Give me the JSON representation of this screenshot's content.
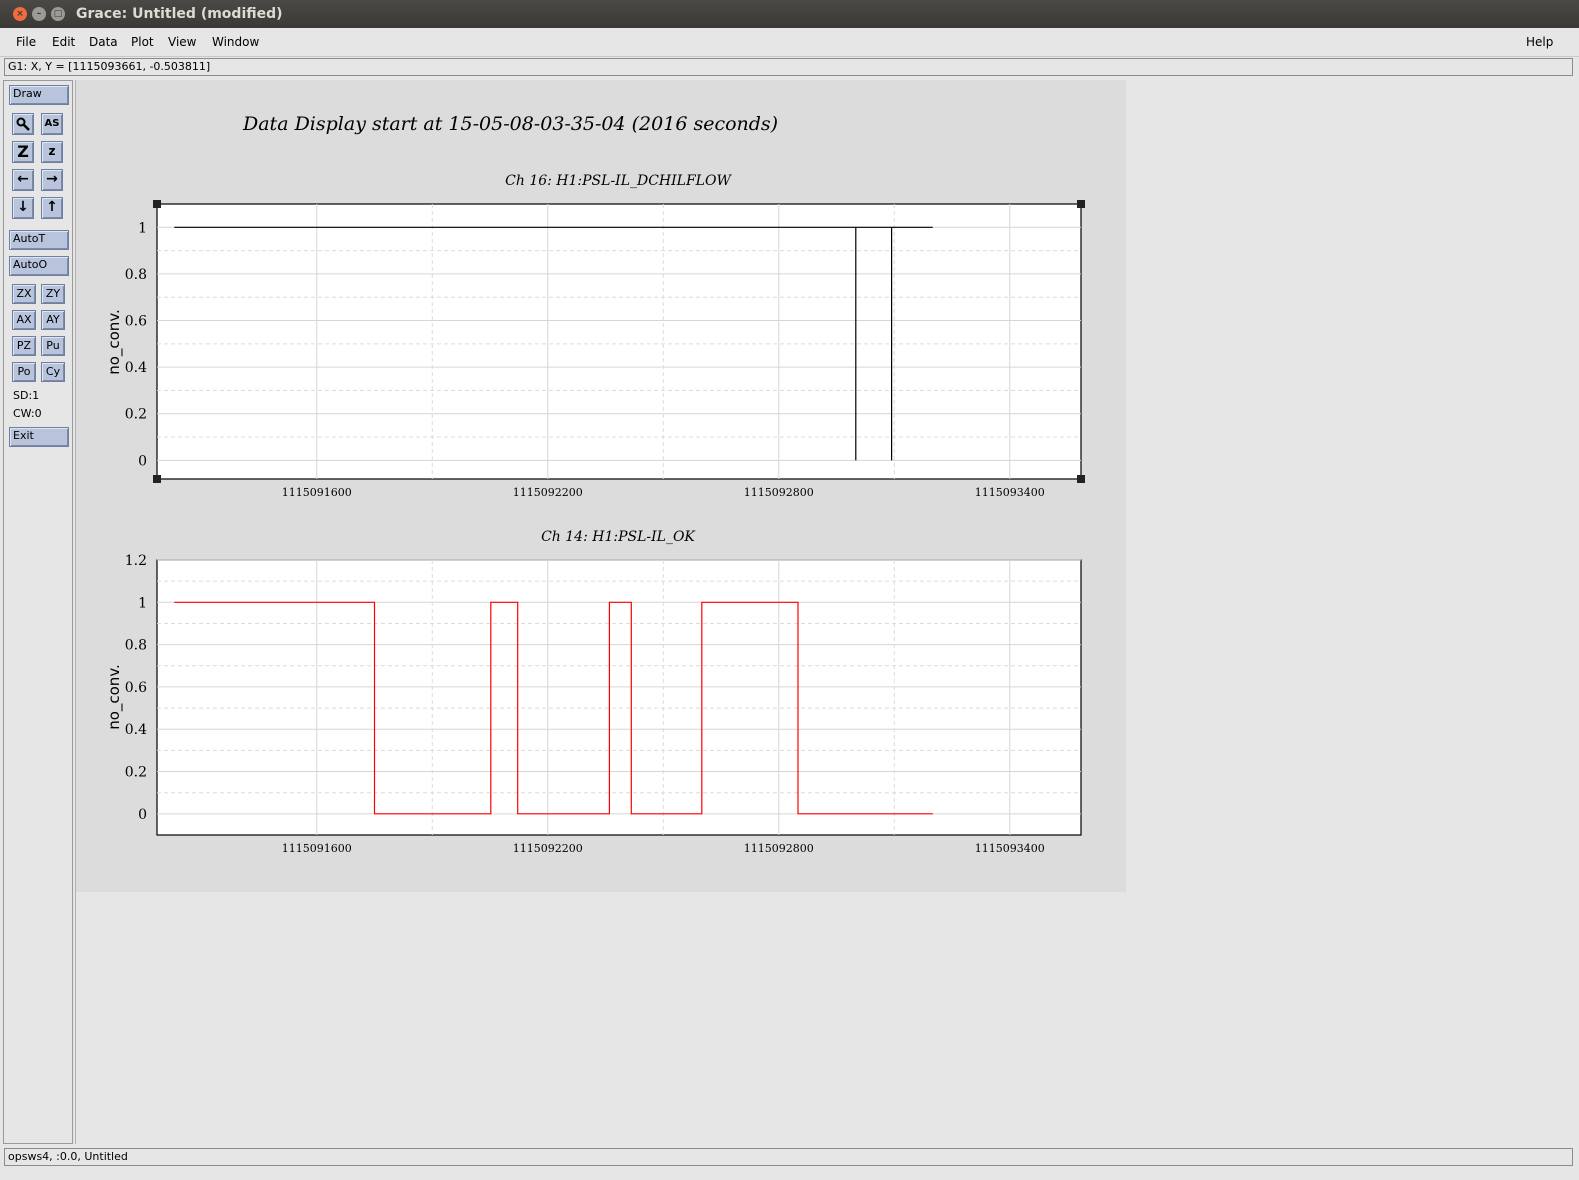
{
  "window": {
    "title": "Grace: Untitled (modified)",
    "close_glyph": "×",
    "min_glyph": "–",
    "max_glyph": "□"
  },
  "menu": {
    "file": "File",
    "edit": "Edit",
    "data": "Data",
    "plot": "Plot",
    "view": "View",
    "window": "Window",
    "help": "Help"
  },
  "locator": "G1: X, Y = [1115093661, -0.503811]",
  "tools": {
    "draw": "Draw",
    "zoom_icon": "magnifier-icon",
    "as_label": "AS",
    "zoom_z": "Z",
    "zoom_z_small": "z",
    "left_arrow": "←",
    "right_arrow": "→",
    "down_arrow": "↓",
    "up_arrow": "↑",
    "autot": "AutoT",
    "autoo": "AutoO",
    "zx": "ZX",
    "zy": "ZY",
    "ax": "AX",
    "ay": "AY",
    "pz": "PZ",
    "pu": "Pu",
    "po": "Po",
    "cy": "Cy",
    "sd": "SD:1",
    "cw": "CW:0",
    "exit": "Exit"
  },
  "status": "opsws4, :0.0, Untitled",
  "page_title": "Data Display start at 15-05-08-03-35-04 (2016 seconds)",
  "colors": {
    "series1": "#000000",
    "series2": "#ff0000",
    "page_bg": "#dcdcdc"
  },
  "chart_data": [
    {
      "type": "line",
      "title": "Ch 16: H1:PSL-IL_DCHILFLOW",
      "ylabel": "no_conv.",
      "xlabel": "",
      "xlim": [
        1115091185,
        1115093585
      ],
      "ylim": [
        -0.08,
        1.1
      ],
      "xticks": [
        1115091600,
        1115092200,
        1115092800,
        1115093400
      ],
      "xtick_labels": [
        "1115091600",
        "1115092200",
        "1115092800",
        "1115093400"
      ],
      "yticks": [
        0,
        0.2,
        0.4,
        0.6,
        0.8,
        1
      ],
      "ytick_labels": [
        "0",
        "0.2",
        "0.4",
        "0.6",
        "0.8",
        "1"
      ],
      "grid": true,
      "series": [
        {
          "x": [
            1115091230,
            1115093000,
            1115093000,
            1115093000,
            1115093093,
            1115093093,
            1115093093,
            1115093200
          ],
          "y": [
            1,
            1,
            0,
            1,
            1,
            0,
            1,
            1
          ]
        }
      ]
    },
    {
      "type": "line",
      "title": "Ch 14: H1:PSL-IL_OK",
      "ylabel": "no_conv.",
      "xlabel": "",
      "xlim": [
        1115091185,
        1115093585
      ],
      "ylim": [
        -0.1,
        1.2
      ],
      "xticks": [
        1115091600,
        1115092200,
        1115092800,
        1115093400
      ],
      "xtick_labels": [
        "1115091600",
        "1115092200",
        "1115092800",
        "1115093400"
      ],
      "yticks": [
        0,
        0.2,
        0.4,
        0.6,
        0.8,
        1,
        1.2
      ],
      "ytick_labels": [
        "0",
        "0.2",
        "0.4",
        "0.6",
        "0.8",
        "1",
        "1.2"
      ],
      "grid": true,
      "series": [
        {
          "x": [
            1115091230,
            1115091750,
            1115091750,
            1115092052,
            1115092052,
            1115092122,
            1115092122,
            1115092360,
            1115092360,
            1115092417,
            1115092417,
            1115092600,
            1115092600,
            1115092850,
            1115092850,
            1115093200
          ],
          "y": [
            1,
            1,
            0,
            0,
            1,
            1,
            0,
            0,
            1,
            1,
            0,
            0,
            1,
            1,
            0,
            0
          ]
        }
      ]
    }
  ]
}
